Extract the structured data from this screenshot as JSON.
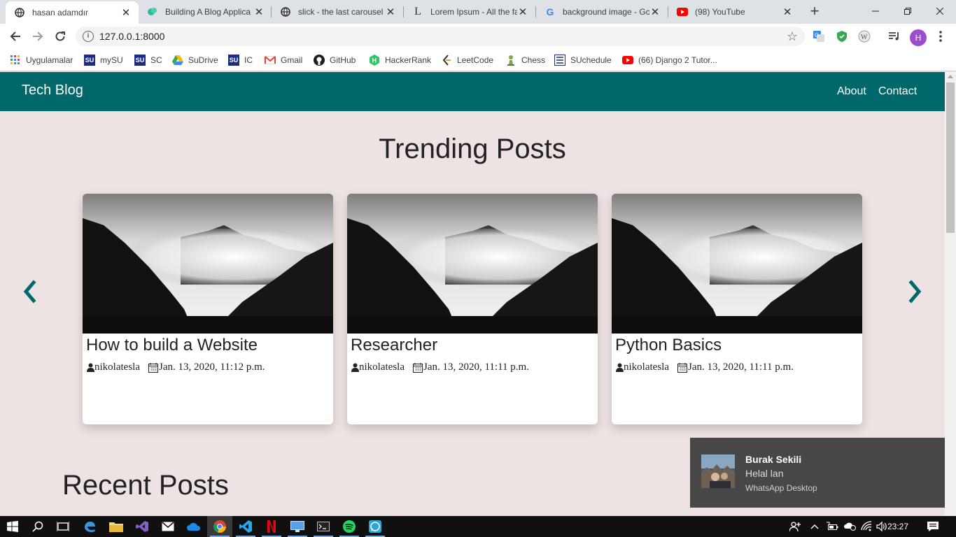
{
  "browser": {
    "tabs": [
      {
        "title": "hasan adamdır",
        "icon": "globe-icon",
        "active": true
      },
      {
        "title": "Building A Blog Applica",
        "icon": "bird-icon"
      },
      {
        "title": "slick - the last carousel",
        "icon": "globe-icon"
      },
      {
        "title": "Lorem Ipsum - All the fa",
        "icon": "lorem-l-icon"
      },
      {
        "title": "background image - Go",
        "icon": "google-icon"
      },
      {
        "title": "(98) YouTube",
        "icon": "youtube-icon"
      }
    ],
    "url": "127.0.0.1:8000",
    "profile_initial": "H",
    "bookmarks": [
      {
        "label": "Uygulamalar",
        "icon": "apps-grid-icon"
      },
      {
        "label": "mySU",
        "icon": "su-icon"
      },
      {
        "label": "SC",
        "icon": "su-icon"
      },
      {
        "label": "SuDrive",
        "icon": "drive-icon"
      },
      {
        "label": "IC",
        "icon": "su-icon"
      },
      {
        "label": "Gmail",
        "icon": "gmail-icon"
      },
      {
        "label": "GitHub",
        "icon": "github-icon"
      },
      {
        "label": "HackerRank",
        "icon": "hackerrank-icon"
      },
      {
        "label": "LeetCode",
        "icon": "leetcode-icon"
      },
      {
        "label": "Chess",
        "icon": "chess-pawn-icon"
      },
      {
        "label": "SUchedule",
        "icon": "suchedule-icon"
      },
      {
        "label": "(66) Django 2 Tutor...",
        "icon": "youtube-icon"
      }
    ]
  },
  "site": {
    "brand": "Tech Blog",
    "nav": {
      "about": "About",
      "contact": "Contact"
    },
    "colors": {
      "navbar": "#00686b",
      "background": "#ede3e2",
      "accent": "#00686b"
    }
  },
  "trending": {
    "heading": "Trending Posts",
    "posts": [
      {
        "title": "How to build a Website",
        "author": "nikolatesla",
        "date": "Jan. 13, 2020, 11:12 p.m."
      },
      {
        "title": "Researcher",
        "author": "nikolatesla",
        "date": "Jan. 13, 2020, 11:11 p.m."
      },
      {
        "title": "Python Basics",
        "author": "nikolatesla",
        "date": "Jan. 13, 2020, 11:11 p.m."
      }
    ]
  },
  "recent": {
    "heading": "Recent Posts"
  },
  "notification": {
    "sender": "Burak Sekili",
    "message": "Helal lan",
    "app": "WhatsApp Desktop"
  },
  "taskbar": {
    "clock": "23:27"
  }
}
